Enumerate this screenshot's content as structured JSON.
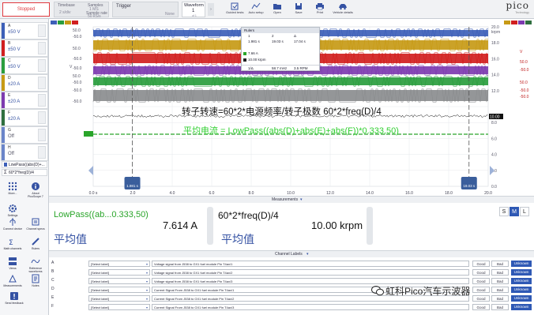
{
  "toolbar": {
    "run_button": "Stopped",
    "timebase": {
      "label": "Timebase",
      "value": "2 s/div"
    },
    "samples": {
      "label1": "Samples",
      "value1": "1 MS",
      "label2": "Sample rate",
      "value2": "50 kS/s"
    },
    "trigger": {
      "label": "Trigger",
      "value": "None"
    },
    "waveform": {
      "label": "Waveform",
      "value": "1",
      "of": "of 1"
    },
    "buttons": [
      "Guided tests",
      "Auto setup",
      "Open",
      "Save",
      "Print",
      "Vehicle details"
    ],
    "logo": "pico",
    "logo_sub": "Technology"
  },
  "channels": [
    {
      "letter": "A",
      "range": "±50 V",
      "color": "#3d5fb8"
    },
    {
      "letter": "B",
      "range": "±50 V",
      "color": "#d11f1f"
    },
    {
      "letter": "C",
      "range": "±50 V",
      "color": "#2a9d3e"
    },
    {
      "letter": "D",
      "range": "±20 A",
      "color": "#c79a16"
    },
    {
      "letter": "E",
      "range": "±20 A",
      "color": "#7d3bb0"
    },
    {
      "letter": "F",
      "range": "±20 A",
      "color": "#2f6f3f"
    },
    {
      "letter": "G",
      "range": "Off",
      "color": "#6b85c9"
    },
    {
      "letter": "H",
      "range": "Off",
      "color": "#6b85c9"
    }
  ],
  "math_channels": [
    "LowPass((abs(D)+...",
    "60*2*freq(D)/4"
  ],
  "sidebar_buttons": [
    "More...",
    "About PicoScope 7",
    "Settings",
    "Connect device",
    "Channel specs",
    "Math channels",
    "Rulers",
    "Views",
    "Reference waveforms",
    "Measurements",
    "Notes",
    "Send feedback"
  ],
  "scope": {
    "left_axis_label": "V",
    "left_axis_ticks": [
      "50.0",
      "-50.0",
      "50.0",
      "-50.0",
      "-50.0",
      "50.0",
      "-50.0",
      "-50.0",
      "-50.0",
      "7.61"
    ],
    "right_axis_unit": "krpm",
    "right_axis_ticks": [
      "20.0",
      "18.0",
      "16.0",
      "14.0",
      "12.0",
      "10.00",
      "8.0",
      "6.0",
      "4.0",
      "2.0",
      "0.0"
    ],
    "far_right_ticks": [
      "V",
      "50.0",
      "-50.0",
      "50.0",
      "-50.0",
      "-50.0"
    ],
    "x_ticks": [
      "0.0 s",
      "2.0",
      "4.0",
      "6.0",
      "8.0",
      "10.0",
      "12.0",
      "14.0",
      "16.0",
      "18.0",
      "20.0"
    ],
    "ruler_labels": [
      "1.981 s",
      "19.03 s"
    ],
    "annotation_rpm": "转子转速=60*2*电源频率/转子极数  60*2*freq(D)/4",
    "annotation_current": "平均电流 = LowPass((abs(D)+abs(E)+abs(F))*0.333,50)",
    "rpm_level": "10.00",
    "current_level": "7.61"
  },
  "rulers_panel": {
    "title": "Rulers",
    "headers": [
      "1",
      "2",
      "Δ"
    ],
    "time_row": [
      "1.981 s",
      "19.03 s",
      "17.04 s"
    ],
    "row_a": [
      "7.66 A",
      "",
      ""
    ],
    "row_b": [
      "10.00 krpm",
      "",
      ""
    ],
    "footer": [
      "1/Δ",
      "58.7 mHz",
      "3.5 RPM"
    ]
  },
  "measurements": {
    "header": "Measurements",
    "cards": [
      {
        "title": "LowPass((ab...0.333,50)",
        "value": "7.614 A",
        "cn_label": "平均值",
        "title_color": "#2aa52a"
      },
      {
        "title": "60*2*freq(D)/4",
        "value": "10.00 krpm",
        "cn_label": "平均值",
        "title_color": "#111111"
      }
    ],
    "size_buttons": [
      "S",
      "M",
      "L"
    ]
  },
  "channel_labels": {
    "header": "Channel Labels",
    "select_placeholder": "[Select label]",
    "good": "Good",
    "bad": "Bad",
    "unknown": "Unknown",
    "rows": [
      {
        "letter": "A",
        "desc": "Voltage signal from J538 to GX1 fuel module Pin T4ax/1"
      },
      {
        "letter": "B",
        "desc": "Voltage signal from J538 to GX1 fuel module Pin T4ax/2"
      },
      {
        "letter": "C",
        "desc": "Voltage signal from J538 to GX1 fuel module Pin T4ax/3"
      },
      {
        "letter": "D",
        "desc": "Current Signal From J538 to GX1 fuel module Pin T4ax/1"
      },
      {
        "letter": "E",
        "desc": "Current Signal From J538 to GX1 fuel module Pin T4ax/2"
      },
      {
        "letter": "F",
        "desc": "Current Signal From J538 to GX1 fuel module Pin T4ax/3"
      }
    ]
  },
  "watermark": "虹科Pico汽车示波器"
}
